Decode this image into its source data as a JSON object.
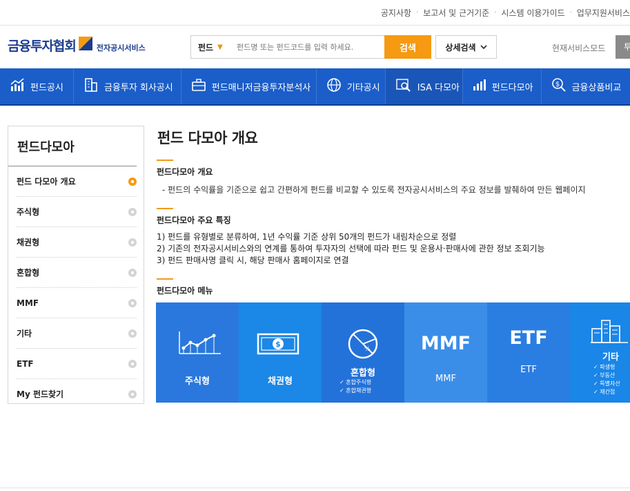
{
  "util_links": [
    "공지사항",
    "보고서 및 근거기준",
    "시스템 이용가이드",
    "업무지원서비스"
  ],
  "logo": {
    "main": "금융투자협회",
    "sub": "전자공시서비스"
  },
  "search": {
    "type_label": "펀드",
    "placeholder": "펀드명 또는 펀드코드를 입력 하세요.",
    "button": "검색",
    "detail": "상세검색"
  },
  "mode": {
    "label": "현재서비스모드",
    "button": "투"
  },
  "colors": {
    "primary": "#1b5ec9",
    "accent": "#f59a12"
  },
  "gnb": [
    {
      "label": "펀드공시",
      "icon": "chart-icon"
    },
    {
      "label": "금융투자 회사공시",
      "icon": "building-icon"
    },
    {
      "label": "펀드매니저금융투자분석사",
      "icon": "briefcase-icon"
    },
    {
      "label": "기타공시",
      "icon": "globe-icon"
    },
    {
      "label": "ISA 다모아",
      "icon": "magnifier-doc-icon"
    },
    {
      "label": "펀드다모아",
      "icon": "bar-chart-icon"
    },
    {
      "label": "금융상품비교",
      "icon": "coin-search-icon"
    }
  ],
  "lnb": {
    "title": "펀드다모아",
    "items": [
      "펀드 다모아 개요",
      "주식형",
      "채권형",
      "혼합형",
      "MMF",
      "기타",
      "ETF",
      "My 펀드찾기"
    ]
  },
  "main": {
    "title": "펀드 다모아 개요",
    "sec1_title": "펀드다모아 개요",
    "sec1_desc": "- 펀드의 수익률을 기준으로 쉽고 간편하게 펀드를 비교할 수 있도록 전자공시서비스의 주요 정보를 발췌하여 만든 웹페이지",
    "sec2_title": "펀드다모아 주요 특징",
    "features": [
      "1) 펀드를 유형별로 분류하여, 1년 수익률 기준 상위 50개의 펀드가 내림차순으로 정렬",
      "2) 기존의 전자공시서비스와의 연계를 통하여 투자자의 선택에 따라 펀드 및 운용사·판매사에 관한 정보 조회기능",
      "3) 펀드 판매사명 클릭 시, 해당 판매사 홈페이지로 연결"
    ],
    "sec3_title": "펀드다모아 메뉴"
  },
  "tiles": [
    {
      "label": "주식형",
      "color": "#2a78dd"
    },
    {
      "label": "채권형",
      "color": "#1b87e6"
    },
    {
      "label": "혼합형",
      "color": "#2372d9",
      "subs": [
        "혼합주식형",
        "혼합채권형"
      ]
    },
    {
      "big": "MMF",
      "label": "MMF",
      "color": "#3a8ee8"
    },
    {
      "big": "ETF",
      "label": "ETF",
      "color": "#2a7ee2"
    },
    {
      "label": "기타",
      "color": "#1a86e8",
      "subs": [
        "파생형",
        "부동산",
        "특별자산",
        "재간접"
      ]
    }
  ]
}
